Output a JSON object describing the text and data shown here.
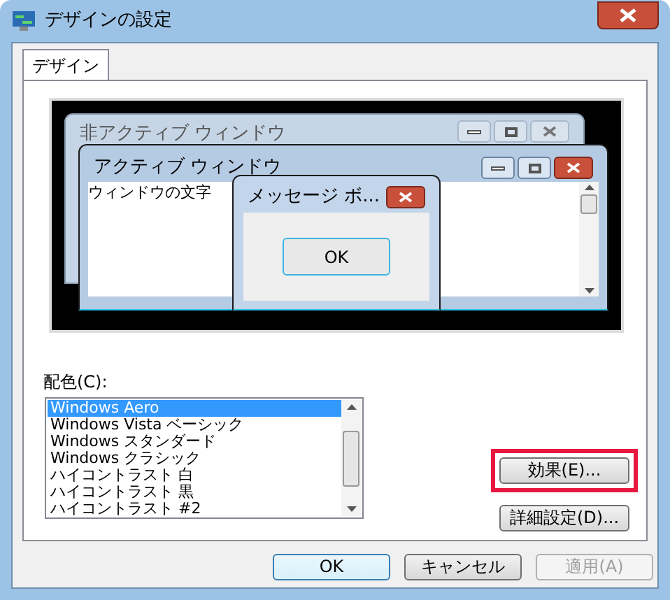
{
  "window": {
    "title": "デザインの設定"
  },
  "tabs": [
    {
      "label": "デザイン",
      "selected": true
    }
  ],
  "preview": {
    "inactive_window_title": "非アクティブ ウィンドウ",
    "active_window_title": "アクティブ ウィンドウ",
    "window_text": "ウィンドウの文字",
    "message_box_title": "メッセージ ボ...",
    "message_box_button": "OK"
  },
  "color_scheme": {
    "label": "配色(C):",
    "items": [
      {
        "label": "Windows Aero",
        "selected": true
      },
      {
        "label": "Windows Vista ベーシック",
        "selected": false
      },
      {
        "label": "Windows スタンダード",
        "selected": false
      },
      {
        "label": "Windows クラシック",
        "selected": false
      },
      {
        "label": "ハイコントラスト 白",
        "selected": false
      },
      {
        "label": "ハイコントラスト 黒",
        "selected": false
      },
      {
        "label": "ハイコントラスト #2",
        "selected": false
      }
    ]
  },
  "side_buttons": [
    {
      "label": "効果(E)...",
      "highlighted": true
    },
    {
      "label": "詳細設定(D)...",
      "highlighted": false
    }
  ],
  "dialog_buttons": [
    {
      "label": "OK",
      "default": true,
      "disabled": false
    },
    {
      "label": "キャンセル",
      "default": false,
      "disabled": false
    },
    {
      "label": "適用(A)",
      "default": false,
      "disabled": true
    }
  ]
}
